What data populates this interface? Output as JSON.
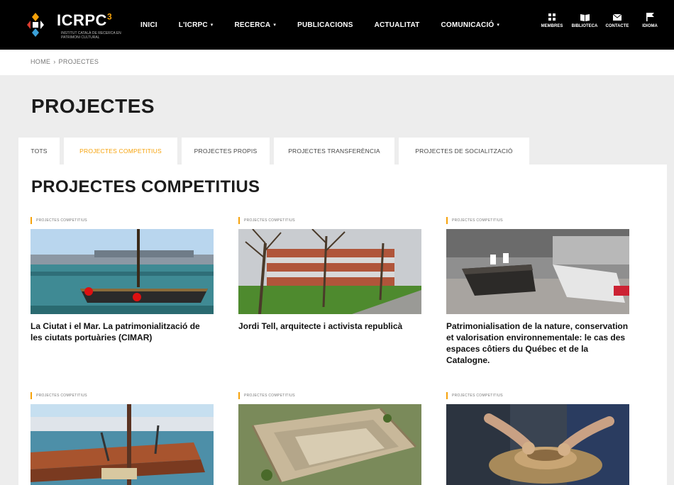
{
  "brand": {
    "name": "ICRPC",
    "superscript": "3",
    "tagline": "INSTITUT CATALÀ DE RECERCA EN PATRIMONI CULTURAL"
  },
  "nav": {
    "items": [
      {
        "label": "INICI",
        "has_caret": false
      },
      {
        "label": "L'ICRPC",
        "has_caret": true
      },
      {
        "label": "RECERCA",
        "has_caret": true
      },
      {
        "label": "PUBLICACIONS",
        "has_caret": false
      },
      {
        "label": "ACTUALITAT",
        "has_caret": false
      },
      {
        "label": "COMUNICACIÓ",
        "has_caret": true
      }
    ],
    "caret": "▾"
  },
  "tools": [
    {
      "label": "MEMBRES",
      "icon": "members-icon"
    },
    {
      "label": "BIBLIOTECA",
      "icon": "book-icon"
    },
    {
      "label": "CONTACTE",
      "icon": "mail-icon"
    },
    {
      "label": "IDIOMA",
      "icon": "flag-icon"
    }
  ],
  "breadcrumb": {
    "home": "HOME",
    "separator": "›",
    "current": "PROJECTES"
  },
  "page": {
    "title": "PROJECTES"
  },
  "tabs": [
    {
      "label": "TOTS",
      "active": false
    },
    {
      "label": "PROJECTES COMPETITIUS",
      "active": true
    },
    {
      "label": "PROJECTES PROPIS",
      "active": false
    },
    {
      "label": "PROJECTES TRANSFERÈNCIA",
      "active": false
    },
    {
      "label": "PROJECTES DE SOCIALITZACIÓ",
      "active": false
    }
  ],
  "section": {
    "title": "PROJECTES COMPETITIUS"
  },
  "cards": [
    {
      "tag": "PROJECTES COMPETITIUS",
      "image": "harbor-boat-photo",
      "title": "La Ciutat i el Mar. La patrimonialització de les ciutats portuàries (CIMAR)"
    },
    {
      "tag": "PROJECTES COMPETITIUS",
      "image": "building-trees-photo",
      "title": "Jordi Tell, arquitecte i activista republicà"
    },
    {
      "tag": "PROJECTES COMPETITIUS",
      "image": "boat-exhibit-photo",
      "title": "Patrimonialisation de la nature, conservation et valorisation environnementale: le cas des espaces côtiers du Québec et de la Catalogne."
    },
    {
      "tag": "PROJECTES COMPETITIUS",
      "image": "fishing-boats-photo",
      "title": ""
    },
    {
      "tag": "PROJECTES COMPETITIUS",
      "image": "archaeological-site-photo",
      "title": ""
    },
    {
      "tag": "PROJECTES COMPETITIUS",
      "image": "pottery-wheel-photo",
      "title": ""
    }
  ],
  "colors": {
    "accent": "#f6a20a",
    "topbar": "#000000",
    "band": "#ededed"
  }
}
